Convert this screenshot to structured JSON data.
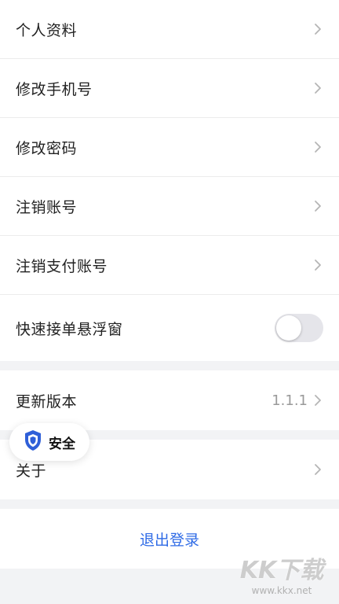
{
  "menu": {
    "items": [
      {
        "label": "个人资料"
      },
      {
        "label": "修改手机号"
      },
      {
        "label": "修改密码"
      },
      {
        "label": "注销账号"
      },
      {
        "label": "注销支付账号"
      }
    ],
    "float_window": {
      "label": "快速接单悬浮窗",
      "enabled": false
    }
  },
  "update": {
    "label": "更新版本",
    "version": "1.1.1"
  },
  "about": {
    "label": "关于"
  },
  "logout_label": "退出登录",
  "security_badge": {
    "label": "安全",
    "icon": "shield-icon",
    "icon_color": "#2f5fd8"
  },
  "watermark": {
    "logo_text": "KK下载",
    "url_text": "www.kkx.net"
  },
  "colors": {
    "accent": "#2f6be6",
    "background": "#f2f3f5"
  }
}
